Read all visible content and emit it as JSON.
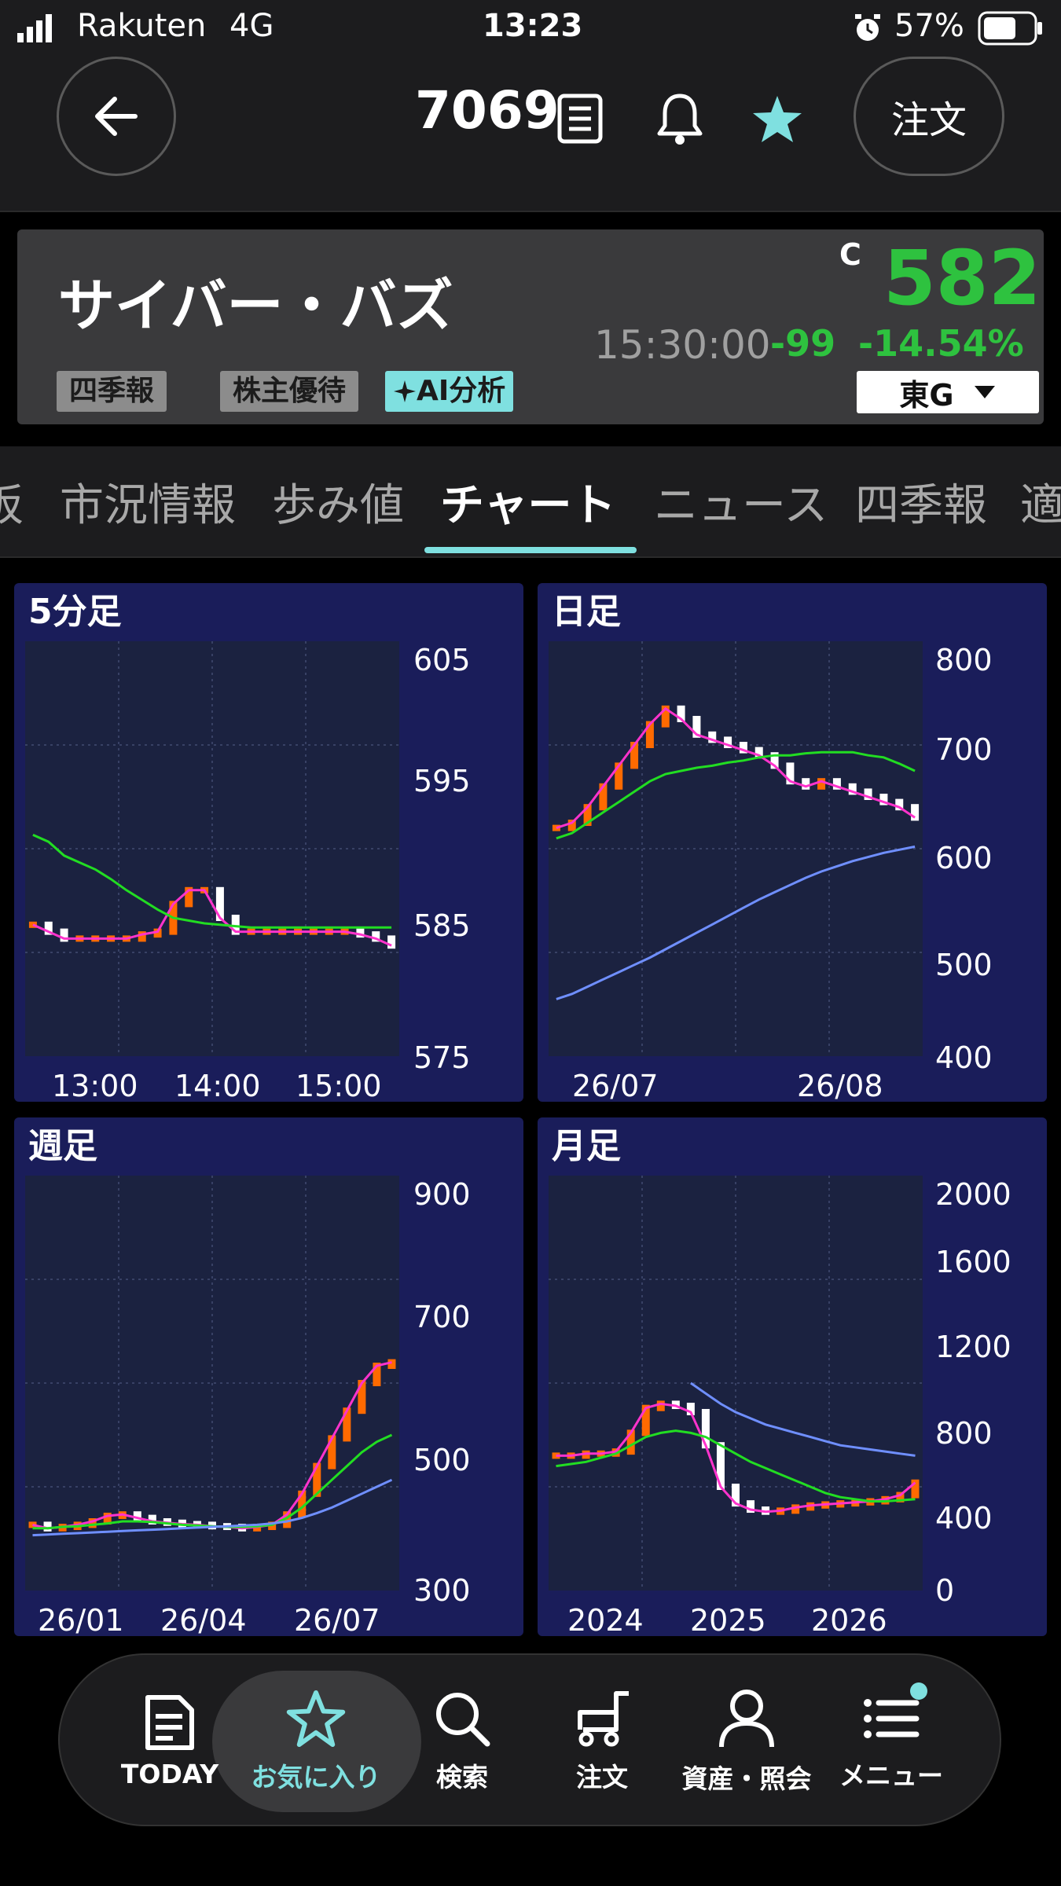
{
  "status_bar": {
    "carrier": "Rakuten",
    "network": "4G",
    "time": "13:23",
    "battery": "57%"
  },
  "header": {
    "stock_code": "7069",
    "order_button": "注文",
    "icons": [
      "back-arrow-icon",
      "document-icon",
      "bell-icon",
      "star-icon"
    ]
  },
  "stock": {
    "name": "サイバー・バズ",
    "price_flag": "C",
    "price": "582",
    "time": "15:30:00",
    "change": "-99",
    "change_pct": "-14.54%",
    "market": "東G",
    "tags": [
      "四季報",
      "株主優待",
      "AI分析"
    ],
    "colors": {
      "price": "#2ec23f",
      "ai_tag_bg": "#7fe0e0"
    }
  },
  "tabs": [
    "板",
    "市況情報",
    "歩み値",
    "チャート",
    "ニュース",
    "四季報",
    "適"
  ],
  "active_tab": "チャート",
  "charts": {
    "min5": {
      "title": "5分足",
      "y_ticks": [
        "605",
        "595",
        "585",
        "575"
      ],
      "x_ticks": [
        "13:00",
        "14:00",
        "15:00"
      ]
    },
    "daily": {
      "title": "日足",
      "y_ticks": [
        "800",
        "700",
        "600",
        "500",
        "400"
      ],
      "x_ticks": [
        "26/07",
        "26/08"
      ]
    },
    "weekly": {
      "title": "週足",
      "y_ticks": [
        "900",
        "700",
        "500",
        "300"
      ],
      "x_ticks": [
        "26/01",
        "26/04",
        "26/07"
      ]
    },
    "monthly": {
      "title": "月足",
      "y_ticks": [
        "2000",
        "1600",
        "1200",
        "800",
        "400",
        "0"
      ],
      "x_ticks": [
        "2024",
        "2025",
        "2026"
      ]
    }
  },
  "chart_colors": {
    "up": "#ff6a00",
    "down": "#ffffff",
    "ma_short": "#ff33cc",
    "ma_mid": "#22dd22",
    "ma_long": "#6f8fff",
    "panel_bg": "#1a1d5a",
    "plot_bg": "#1b2240"
  },
  "chart_data": [
    {
      "type": "line",
      "title": "5分足",
      "x_ticks": [
        "13:00",
        "14:00",
        "15:00"
      ],
      "ylim": [
        575,
        605
      ],
      "series": [
        {
          "values": [
            584.5,
            584,
            583.5,
            583.5,
            583.5,
            583.5,
            583.5,
            583.8,
            584,
            586,
            587,
            587,
            585,
            584,
            584,
            584,
            584,
            584,
            584,
            584,
            584,
            583.8,
            583.5,
            583
          ]
        },
        {
          "values": [
            591,
            590.5,
            589.5,
            589,
            588.5,
            587.8,
            587,
            586.3,
            585.6,
            585,
            584.8,
            584.6,
            584.5,
            584.4,
            584.3,
            584.3,
            584.3,
            584.3,
            584.3,
            584.3,
            584.3,
            584.3,
            584.3,
            584.3
          ]
        }
      ]
    },
    {
      "type": "line",
      "title": "日足",
      "x_ticks": [
        "26/07",
        "26/08"
      ],
      "ylim": [
        400,
        800
      ],
      "series": [
        {
          "values": [
            620,
            625,
            640,
            660,
            680,
            700,
            720,
            735,
            725,
            710,
            705,
            700,
            695,
            690,
            680,
            665,
            660,
            665,
            660,
            655,
            650,
            645,
            640,
            630
          ]
        },
        {
          "values": [
            610,
            615,
            625,
            635,
            645,
            655,
            665,
            672,
            675,
            678,
            680,
            683,
            685,
            688,
            690,
            690,
            692,
            693,
            693,
            693,
            690,
            688,
            682,
            675
          ]
        },
        {
          "values": [
            455,
            460,
            467,
            474,
            481,
            488,
            495,
            503,
            511,
            519,
            527,
            535,
            543,
            551,
            558,
            565,
            572,
            578,
            583,
            588,
            592,
            596,
            599,
            602
          ]
        }
      ]
    },
    {
      "type": "line",
      "title": "週足",
      "x_ticks": [
        "26/01",
        "26/04",
        "26/07"
      ],
      "ylim": [
        300,
        900
      ],
      "series": [
        {
          "values": [
            395,
            390,
            392,
            395,
            400,
            408,
            410,
            405,
            400,
            398,
            396,
            395,
            393,
            392,
            390,
            392,
            395,
            410,
            440,
            480,
            520,
            560,
            600,
            625,
            630
          ]
        },
        {
          "values": [
            390,
            390,
            392,
            393,
            395,
            397,
            400,
            400,
            399,
            397,
            395,
            394,
            393,
            392,
            392,
            393,
            395,
            405,
            420,
            440,
            460,
            480,
            500,
            515,
            525
          ]
        },
        {
          "values": [
            380,
            381,
            382,
            383,
            384,
            385,
            386,
            387,
            388,
            389,
            390,
            391,
            392,
            393,
            394,
            395,
            397,
            400,
            405,
            412,
            420,
            430,
            440,
            450,
            460
          ]
        }
      ]
    },
    {
      "type": "line",
      "title": "月足",
      "x_ticks": [
        "2024",
        "2025",
        "2026"
      ],
      "ylim": [
        0,
        2000
      ],
      "series": [
        {
          "values": [
            650,
            650,
            660,
            660,
            670,
            760,
            880,
            900,
            890,
            860,
            700,
            500,
            420,
            390,
            380,
            385,
            400,
            410,
            415,
            420,
            425,
            430,
            440,
            460,
            520
          ]
        },
        {
          "values": [
            600,
            610,
            620,
            640,
            660,
            700,
            740,
            760,
            770,
            760,
            740,
            700,
            660,
            620,
            590,
            560,
            530,
            500,
            470,
            450,
            440,
            430,
            430,
            435,
            440
          ]
        },
        {
          "values": [
            null,
            null,
            null,
            null,
            null,
            null,
            null,
            null,
            null,
            1000,
            950,
            900,
            860,
            830,
            800,
            780,
            760,
            740,
            720,
            700,
            690,
            680,
            670,
            660,
            650
          ]
        }
      ]
    }
  ],
  "bottom_nav": [
    {
      "label": "TODAY",
      "icon": "newspaper-icon"
    },
    {
      "label": "お気に入り",
      "icon": "star-outline-icon"
    },
    {
      "label": "検索",
      "icon": "search-icon"
    },
    {
      "label": "注文",
      "icon": "cart-icon"
    },
    {
      "label": "資産・照会",
      "icon": "person-icon"
    },
    {
      "label": "メニュー",
      "icon": "menu-icon"
    }
  ]
}
